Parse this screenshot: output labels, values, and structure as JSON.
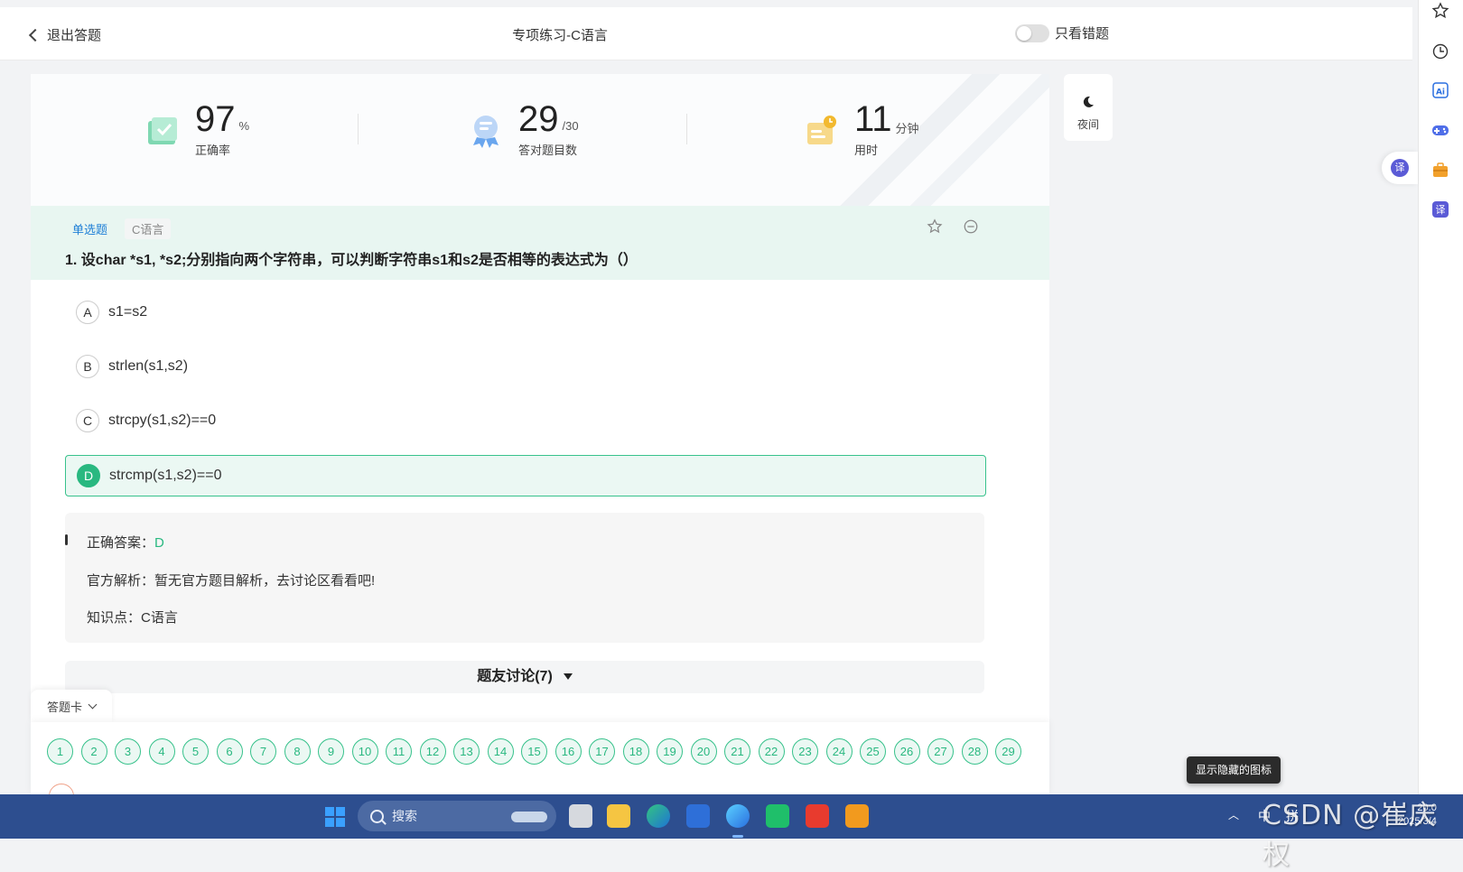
{
  "header": {
    "back_label": "退出答题",
    "title": "专项练习-C语言",
    "toggle_label": "只看错题"
  },
  "stats": {
    "accuracy": {
      "value": "97",
      "unit": "%",
      "label": "正确率"
    },
    "correct": {
      "value": "29",
      "unit": "/30",
      "label": "答对题目数"
    },
    "time": {
      "value": "11",
      "unit": "分钟",
      "label": "用时"
    }
  },
  "night_mode_label": "夜间",
  "question": {
    "type_tag": "单选题",
    "topic_tag": "C语言",
    "title": "1. 设char *s1, *s2;分别指向两个字符串，可以判断字符串s1和s2是否相等的表达式为（）",
    "options": [
      {
        "letter": "A",
        "text": "s1=s2"
      },
      {
        "letter": "B",
        "text": "strlen(s1,s2)"
      },
      {
        "letter": "C",
        "text": "strcpy(s1,s2)==0"
      },
      {
        "letter": "D",
        "text": "strcmp(s1,s2)==0"
      }
    ]
  },
  "analysis": {
    "answer_label": "正确答案：",
    "answer_value": "D",
    "official_label": "官方解析：",
    "official_text": "暂无官方题目解析，去讨论区看看吧!",
    "knowledge_label": "知识点：",
    "knowledge_value": "C语言"
  },
  "discussion_label": "题友讨论(7)",
  "answer_card": {
    "tab_label": "答题卡",
    "numbers": [
      "1",
      "2",
      "3",
      "4",
      "5",
      "6",
      "7",
      "8",
      "9",
      "10",
      "11",
      "12",
      "13",
      "14",
      "15",
      "16",
      "17",
      "18",
      "19",
      "20",
      "21",
      "22",
      "23",
      "24",
      "25",
      "26",
      "27",
      "28",
      "29"
    ]
  },
  "tooltip": "显示隐藏的图标",
  "taskbar": {
    "search_placeholder": "搜索",
    "ime_lang": "中",
    "ime_mode": "拼",
    "time": "20:0",
    "date": "2025/3/4"
  },
  "watermark": "CSDN @崔庆权",
  "colors": {
    "accent_green": "#29b880",
    "question_header_bg": "#e8f6f1",
    "taskbar_bg": "#2d4e8f",
    "tag_blue": "#1e7fd6"
  },
  "icons": [
    "chevron-left-icon",
    "checkbook-icon",
    "award-icon",
    "clock-book-icon",
    "star-icon",
    "minus-circle-icon",
    "moon-icon",
    "bookmark-star-icon",
    "history-icon",
    "ai-icon",
    "gamepad-icon",
    "toolbox-icon",
    "translate-icon",
    "windows-start-icon",
    "search-icon"
  ]
}
